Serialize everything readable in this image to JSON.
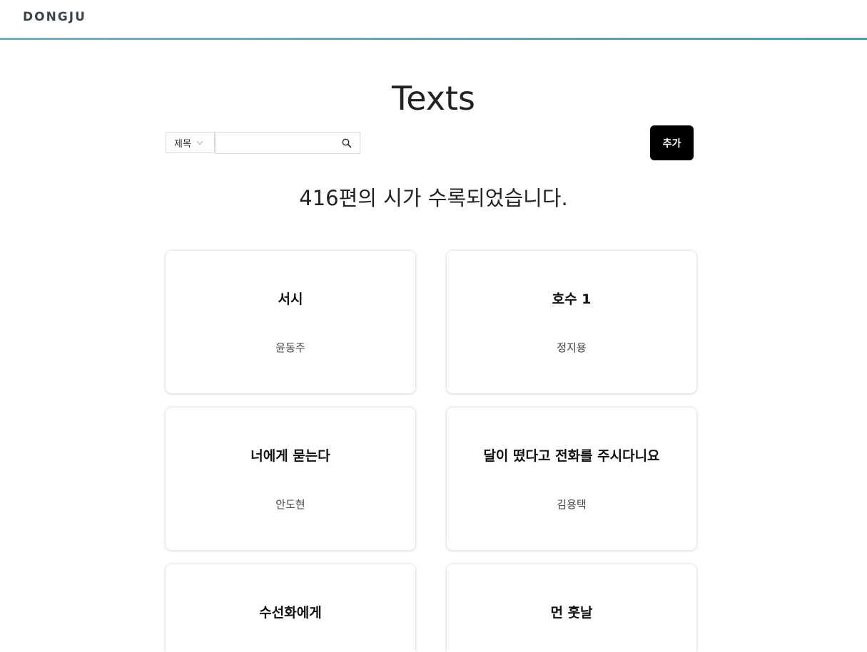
{
  "header": {
    "logo": "DONGJU"
  },
  "main": {
    "title": "Texts",
    "search": {
      "field_select": "제목",
      "input_value": "",
      "input_placeholder": ""
    },
    "add_button": "추가",
    "count_text": "416편의 시가 수록되었습니다.",
    "poems": [
      {
        "title": "서시",
        "author": "윤동주"
      },
      {
        "title": "호수 1",
        "author": "정지용"
      },
      {
        "title": "너에게 묻는다",
        "author": "안도현"
      },
      {
        "title": "달이 떴다고 전화를 주시다니요",
        "author": "김용택"
      },
      {
        "title": "수선화에게",
        "author": ""
      },
      {
        "title": "먼 훗날",
        "author": ""
      }
    ]
  },
  "colors": {
    "accent_line": "#4aa0ab",
    "button_bg": "#000000",
    "logo": "#3d434a"
  }
}
